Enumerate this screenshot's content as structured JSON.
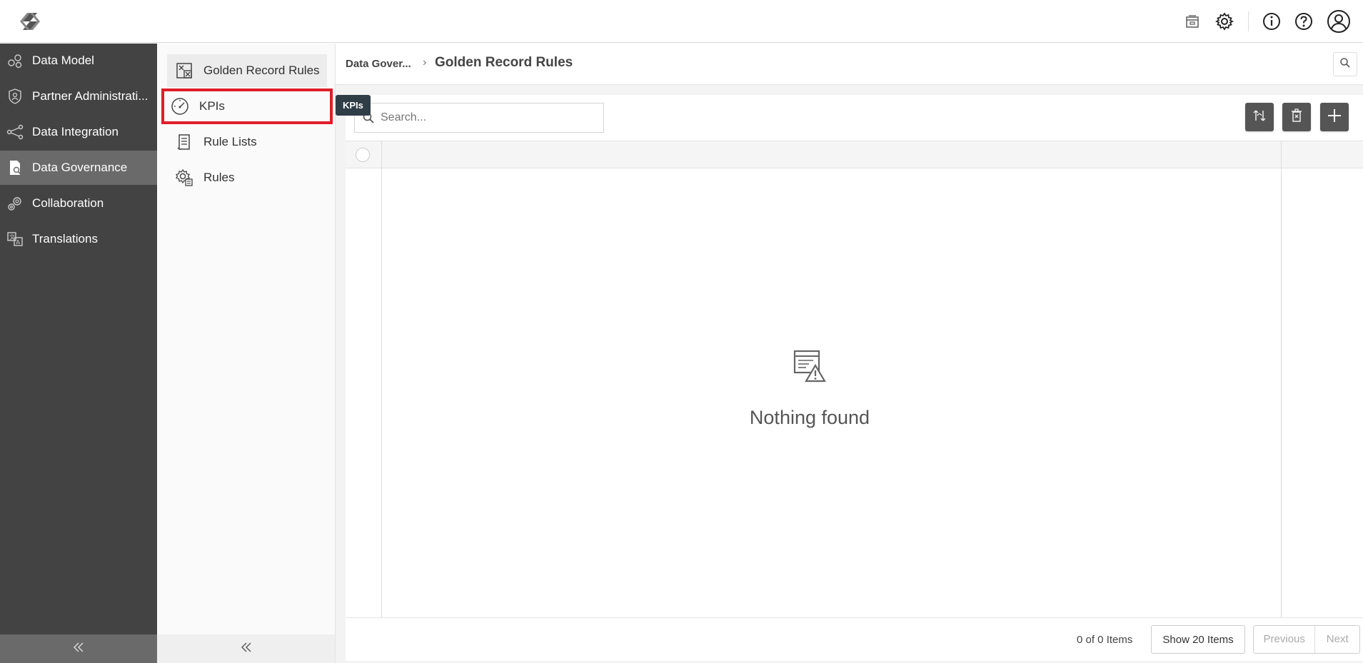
{
  "app": {
    "logo": "app-logo",
    "accent_color": "#434343",
    "focus_color": "#e01e2a"
  },
  "topbar": {
    "icons": [
      "archive-icon",
      "gear-icon",
      "info-icon",
      "help-icon",
      "user-icon"
    ]
  },
  "sidebar": {
    "items": [
      {
        "label": "Data Model",
        "icon": "data-model-icon"
      },
      {
        "label": "Partner Administrati...",
        "icon": "partner-shield-icon"
      },
      {
        "label": "Data Integration",
        "icon": "integration-icon"
      },
      {
        "label": "Data Governance",
        "icon": "governance-icon",
        "active": true
      },
      {
        "label": "Collaboration",
        "icon": "collaboration-icon"
      },
      {
        "label": "Translations",
        "icon": "translations-icon"
      }
    ],
    "collapse_label": "«"
  },
  "subnav": {
    "items": [
      {
        "label": "Golden Record Rules",
        "icon": "golden-record-icon",
        "selected": true
      },
      {
        "label": "KPIs",
        "icon": "speedometer-icon",
        "focused": true
      },
      {
        "label": "Rule Lists",
        "icon": "rule-list-icon"
      },
      {
        "label": "Rules",
        "icon": "rules-gear-icon"
      }
    ],
    "tooltip": "KPIs"
  },
  "breadcrumb": {
    "parent": "Data Gover...",
    "separator": "›",
    "current": "Golden Record Rules"
  },
  "grid": {
    "search_placeholder": "Search...",
    "empty_message": "Nothing found",
    "count_text": "0 of 0 Items",
    "page_size_label": "Show 20 Items",
    "previous_label": "Previous",
    "next_label": "Next"
  }
}
